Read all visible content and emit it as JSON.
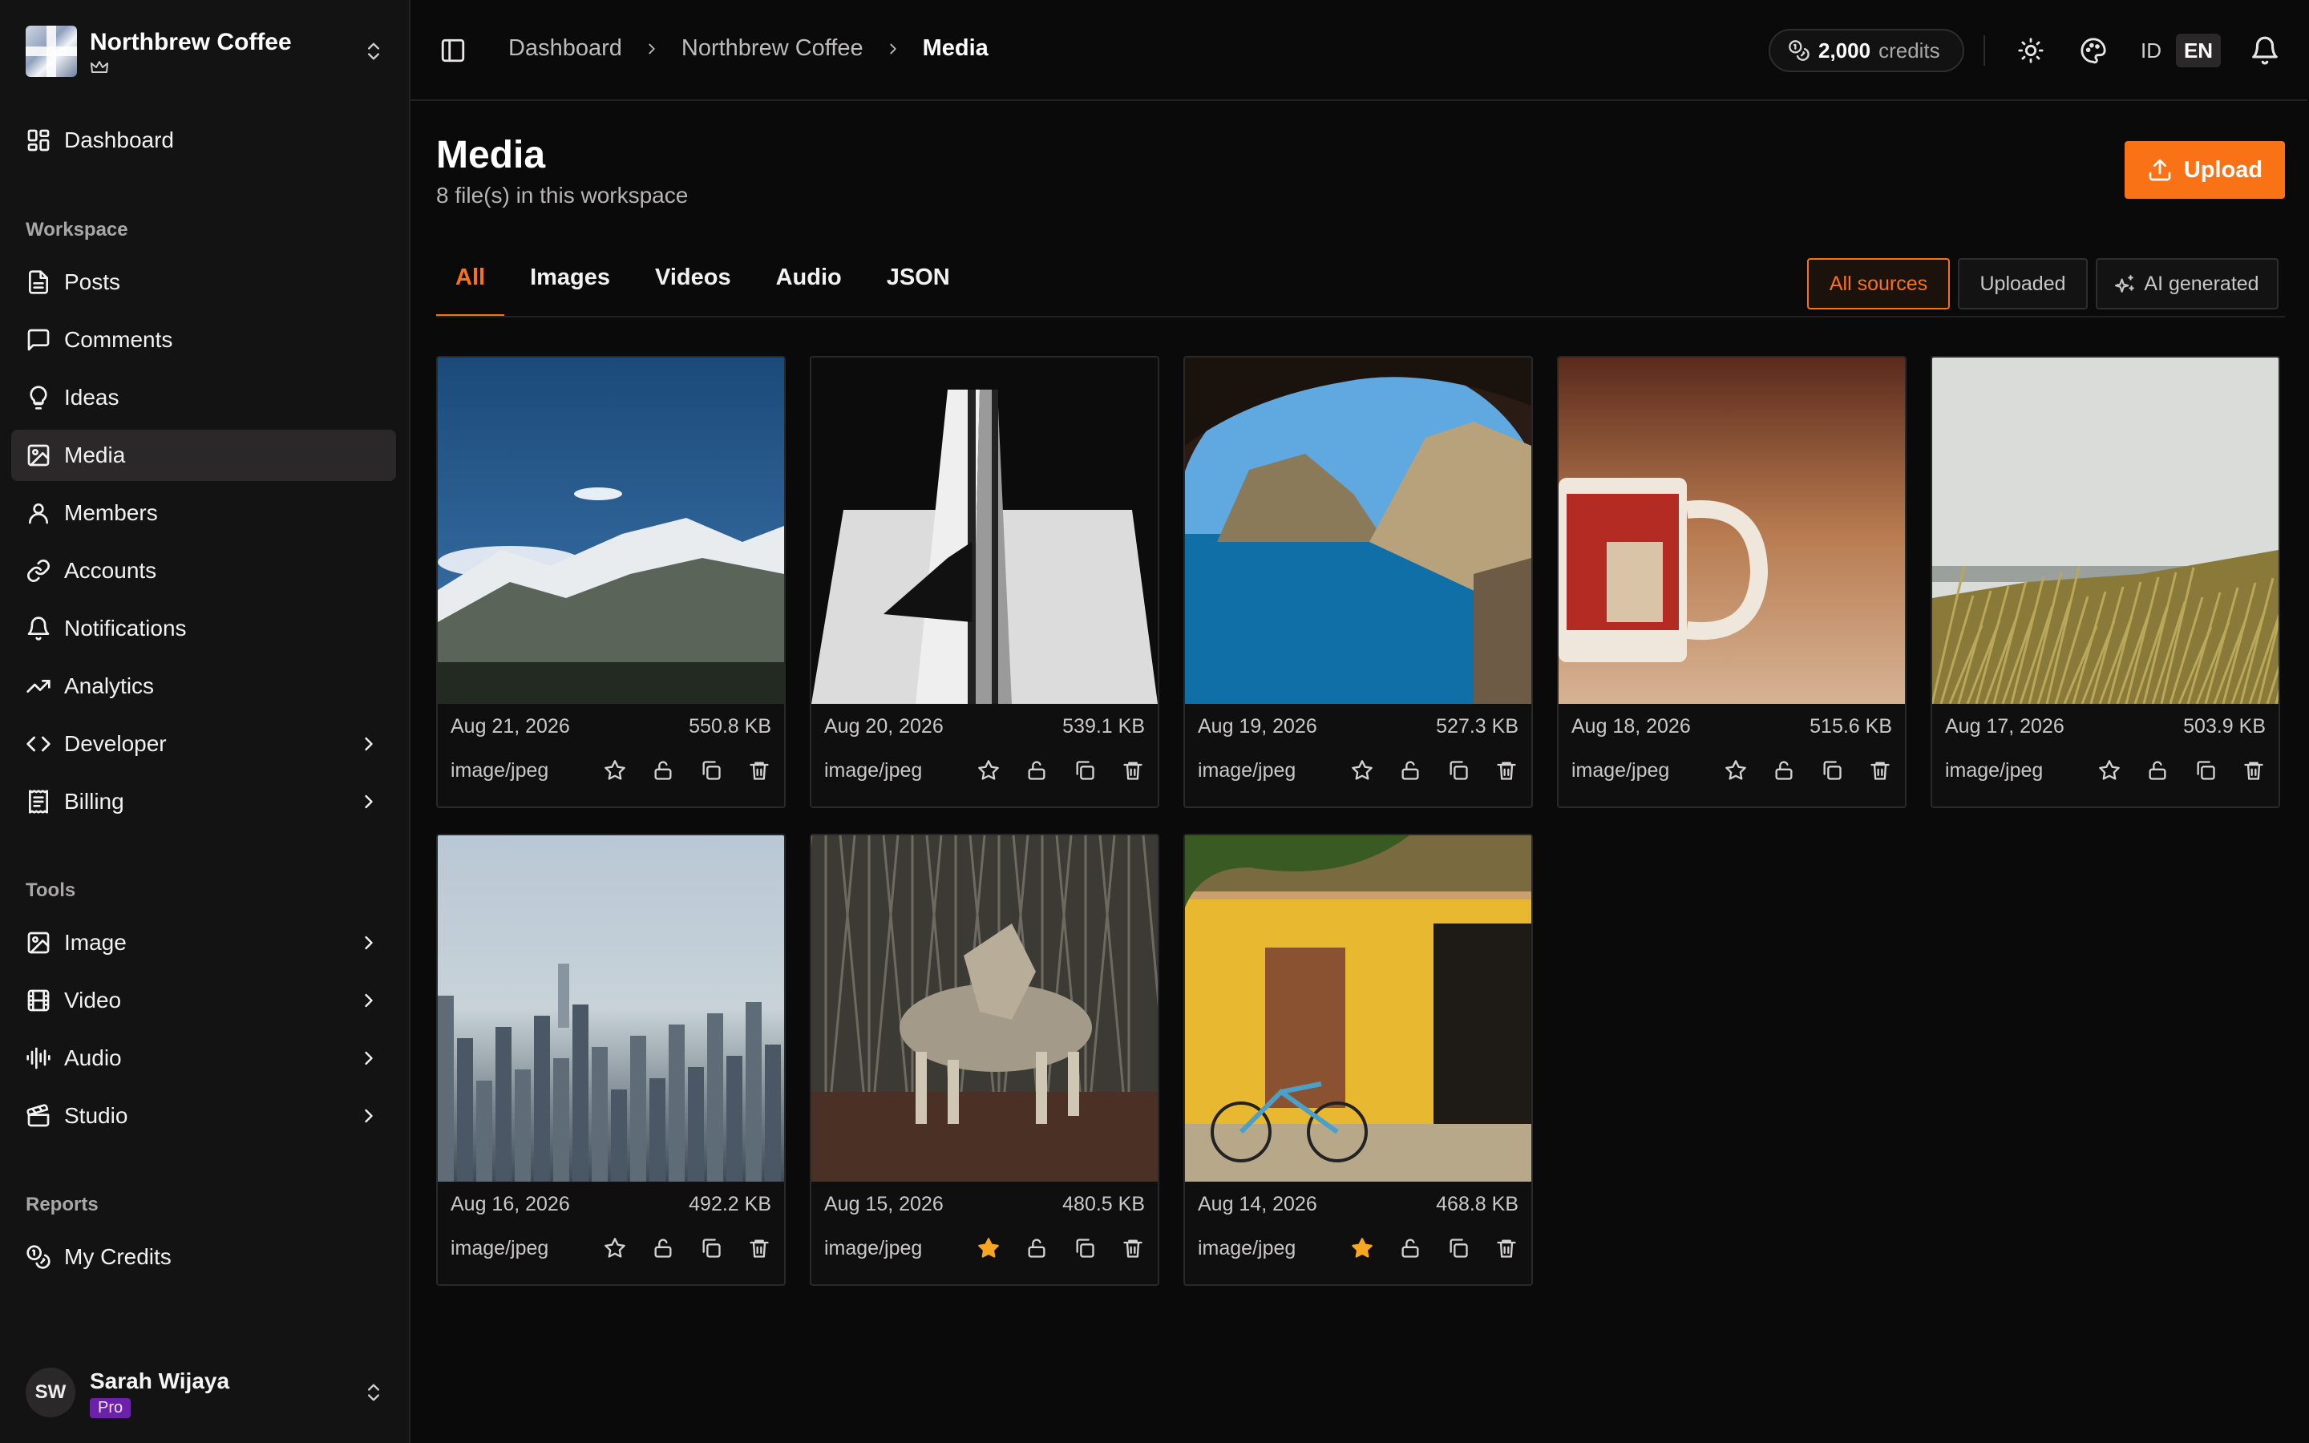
{
  "workspace": {
    "name": "Northbrew Coffee"
  },
  "nav": {
    "dashboard": "Dashboard",
    "sections": {
      "workspace": "Workspace",
      "tools": "Tools",
      "reports": "Reports"
    },
    "workspace_items": [
      "Posts",
      "Comments",
      "Ideas",
      "Media",
      "Members",
      "Accounts",
      "Notifications",
      "Analytics",
      "Developer",
      "Billing"
    ],
    "tools_items": [
      "Image",
      "Video",
      "Audio",
      "Studio"
    ],
    "reports_items": [
      "My Credits"
    ],
    "active": "Media"
  },
  "user": {
    "initials": "SW",
    "name": "Sarah Wijaya",
    "plan": "Pro"
  },
  "breadcrumb": [
    "Dashboard",
    "Northbrew Coffee",
    "Media"
  ],
  "topbar": {
    "credits_value": "2,000",
    "credits_label": "credits",
    "lang_id": "ID",
    "lang_en": "EN",
    "active_lang": "EN"
  },
  "page": {
    "title": "Media",
    "subtitle": "8 file(s) in this workspace",
    "upload_label": "Upload"
  },
  "tabs": [
    "All",
    "Images",
    "Videos",
    "Audio",
    "JSON"
  ],
  "active_tab": "All",
  "filters": [
    "All sources",
    "Uploaded",
    "AI generated"
  ],
  "active_filter": "All sources",
  "colors": {
    "accent": "#f97316",
    "star_active": "#f5a623",
    "plan_badge": "#6b21a8"
  },
  "media": [
    {
      "date": "Aug 21, 2026",
      "size": "550.8 KB",
      "mime": "image/jpeg",
      "starred": false,
      "subject": "snowy mountains"
    },
    {
      "date": "Aug 20, 2026",
      "size": "539.1 KB",
      "mime": "image/jpeg",
      "starred": false,
      "subject": "white architecture"
    },
    {
      "date": "Aug 19, 2026",
      "size": "527.3 KB",
      "mime": "image/jpeg",
      "starred": false,
      "subject": "sea cave"
    },
    {
      "date": "Aug 18, 2026",
      "size": "515.6 KB",
      "mime": "image/jpeg",
      "starred": false,
      "subject": "coffee mug"
    },
    {
      "date": "Aug 17, 2026",
      "size": "503.9 KB",
      "mime": "image/jpeg",
      "starred": false,
      "subject": "dune grass"
    },
    {
      "date": "Aug 16, 2026",
      "size": "492.2 KB",
      "mime": "image/jpeg",
      "starred": false,
      "subject": "foggy city"
    },
    {
      "date": "Aug 15, 2026",
      "size": "480.5 KB",
      "mime": "image/jpeg",
      "starred": true,
      "subject": "coyote"
    },
    {
      "date": "Aug 14, 2026",
      "size": "468.8 KB",
      "mime": "image/jpeg",
      "starred": true,
      "subject": "yellow house with bicycle"
    }
  ]
}
